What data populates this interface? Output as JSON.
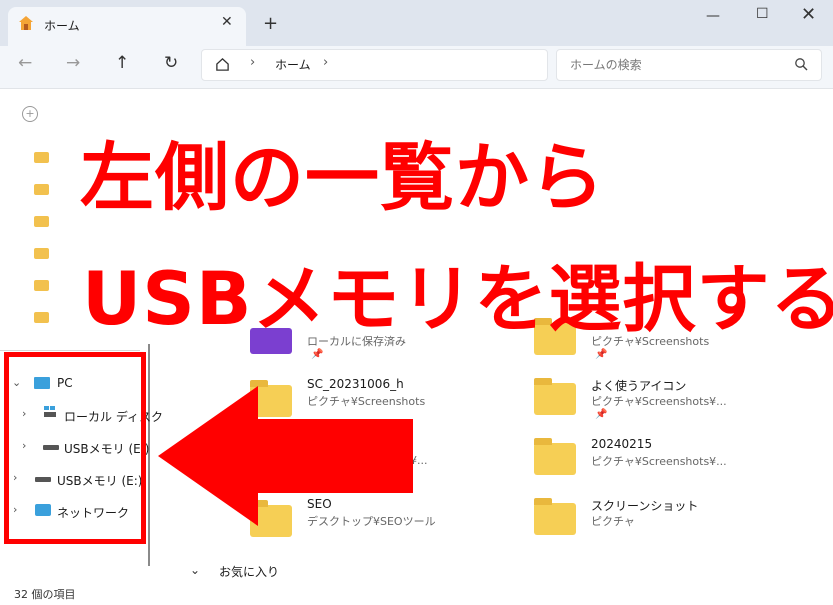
{
  "window": {
    "tab_title": "ホーム",
    "tab_close": "✕",
    "new_tab": "+",
    "min": "—",
    "max": "☐",
    "close": "✕"
  },
  "nav": {
    "back": "←",
    "forward": "→",
    "up": "↑",
    "refresh": "↻",
    "sep": "›",
    "address": "ホーム",
    "search_placeholder": "ホームの検索"
  },
  "overlay": {
    "line1": "左側の一覧から",
    "line2": "USBメモリを選択する",
    "arrow_color": "#ff0000"
  },
  "sidebar": {
    "tree": [
      {
        "label": "PC",
        "chevron": "⌄"
      },
      {
        "label": "ローカル ディスク",
        "chevron": "›"
      },
      {
        "label": "USBメモリ (E:)",
        "chevron": "›"
      },
      {
        "label": "USBメモリ (E:)",
        "chevron": "›"
      },
      {
        "label": "ネットワーク",
        "chevron": "›"
      }
    ]
  },
  "tiles": [
    {
      "name": "",
      "sub": "ローカルに保存済み",
      "type": "video"
    },
    {
      "name": "",
      "sub": "ピクチャ¥Screenshots",
      "type": "folder"
    },
    {
      "name": "SC_20231006_h",
      "sub": "ピクチャ¥Screenshots",
      "type": "folder"
    },
    {
      "name": "よく使うアイコン",
      "sub": "ピクチャ¥Screenshots¥...",
      "type": "folder"
    },
    {
      "name": "",
      "sub": "¥...",
      "type": "folder"
    },
    {
      "name": "20240215",
      "sub": "ピクチャ¥Screenshots¥...",
      "type": "folder"
    },
    {
      "name": "SEO",
      "sub": "デスクトップ¥SEOツール",
      "type": "folder"
    },
    {
      "name": "スクリーンショット",
      "sub": "ピクチャ",
      "type": "folder"
    }
  ],
  "favorites": {
    "chevron": "⌄",
    "label": "お気に入り"
  },
  "status": {
    "text": "32 個の項目"
  },
  "colors": {
    "accent": "#ff0000",
    "folder": "#f6cf55"
  }
}
